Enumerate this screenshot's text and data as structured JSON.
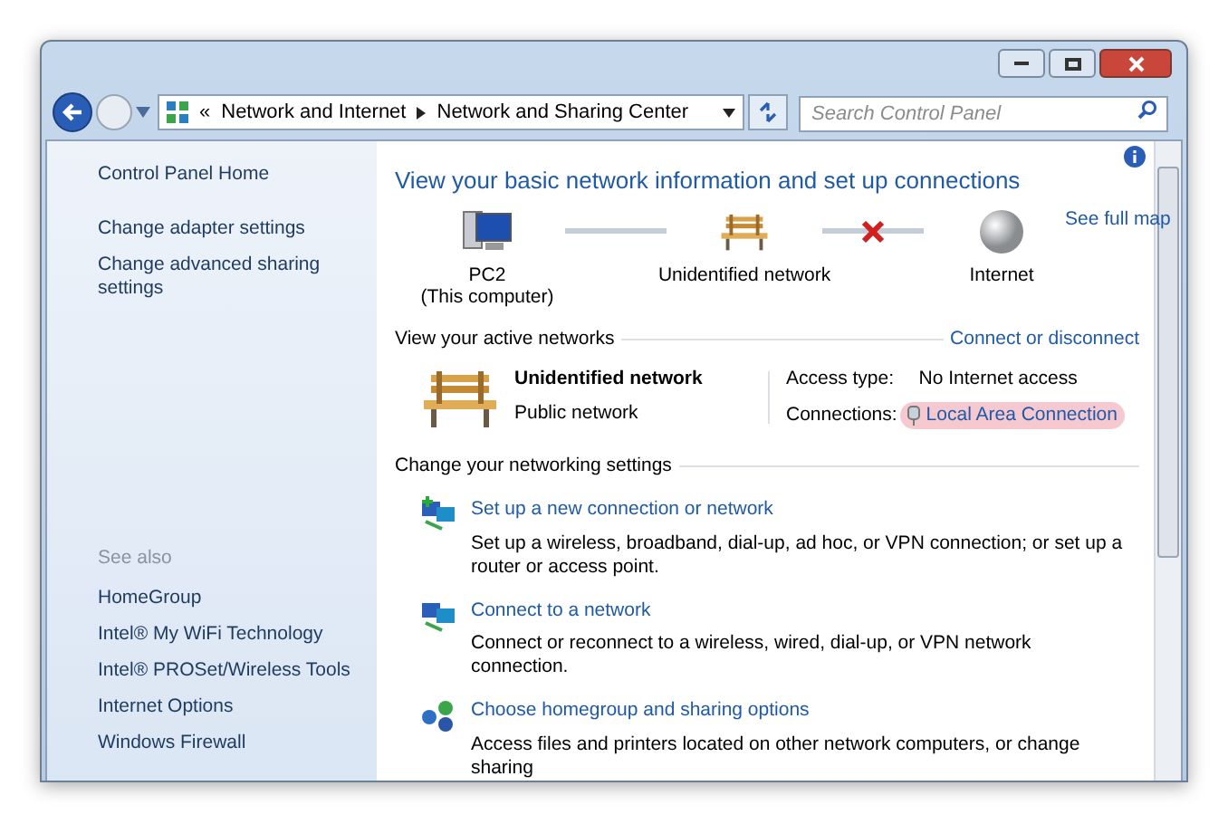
{
  "address_bar": {
    "breadcrumbs": [
      "Network and Internet",
      "Network and Sharing Center"
    ],
    "overflow": "«"
  },
  "search": {
    "placeholder": "Search Control Panel"
  },
  "sidebar": {
    "items": [
      {
        "label": "Control Panel Home"
      },
      {
        "label": "Change adapter settings"
      },
      {
        "label": "Change advanced sharing settings"
      }
    ],
    "see_also_heading": "See also",
    "see_also": [
      "HomeGroup",
      "Intel® My WiFi Technology",
      "Intel® PROSet/Wireless Tools",
      "Internet Options",
      "Windows Firewall"
    ]
  },
  "main": {
    "title": "View your basic network information and set up connections",
    "see_full_map": "See full map",
    "map": [
      {
        "kind": "computer",
        "label": "PC2",
        "sublabel": "(This computer)",
        "link_broken": false
      },
      {
        "kind": "network",
        "label": "Unidentified network",
        "link_broken": true
      },
      {
        "kind": "internet",
        "label": "Internet"
      }
    ],
    "active_heading": "View your active networks",
    "connect_link": "Connect or disconnect",
    "active_network": {
      "name": "Unidentified network",
      "type": "Public network",
      "access_label": "Access type:",
      "access_value": "No Internet access",
      "connections_label": "Connections:",
      "connection": "Local Area Connection",
      "connection_highlighted": true
    },
    "settings_heading": "Change your networking settings",
    "tasks": [
      {
        "kind": "new-connection",
        "title": "Set up a new connection or network",
        "description": "Set up a wireless, broadband, dial-up, ad hoc, or VPN connection; or set up a router or access point."
      },
      {
        "kind": "connect",
        "title": "Connect to a network",
        "description": "Connect or reconnect to a wireless, wired, dial-up, or VPN network connection."
      },
      {
        "kind": "homegroup",
        "title": "Choose homegroup and sharing options",
        "description": "Access files and printers located on other network computers, or change sharing"
      }
    ]
  }
}
